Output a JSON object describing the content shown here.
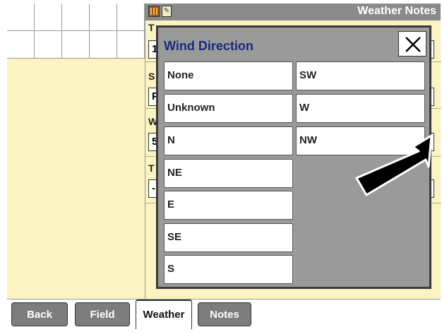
{
  "header": {
    "title": "Weather Notes",
    "icons": [
      "grid-icon",
      "note-icon"
    ]
  },
  "form": {
    "rows": [
      {
        "label": "T",
        "value": "1"
      },
      {
        "label": "S",
        "value": "P"
      },
      {
        "label": "W",
        "value": "5"
      },
      {
        "label": "T",
        "value": "-"
      }
    ]
  },
  "modal": {
    "title": "Wind Direction",
    "close_icon": "close-icon",
    "options_left": [
      "None",
      "Unknown",
      "N",
      "NE",
      "E",
      "SE",
      "S"
    ],
    "options_right": [
      "SW",
      "W",
      "NW"
    ]
  },
  "tabs": [
    {
      "label": "Back",
      "active": false
    },
    {
      "label": "Field",
      "active": false
    },
    {
      "label": "Weather",
      "active": true
    },
    {
      "label": "Notes",
      "active": false
    }
  ],
  "colors": {
    "panel_bg": "#fbf3c2",
    "header_bg": "#8a8a8a",
    "modal_bg": "#9a9a9a",
    "title_text": "#1a2a7a"
  }
}
